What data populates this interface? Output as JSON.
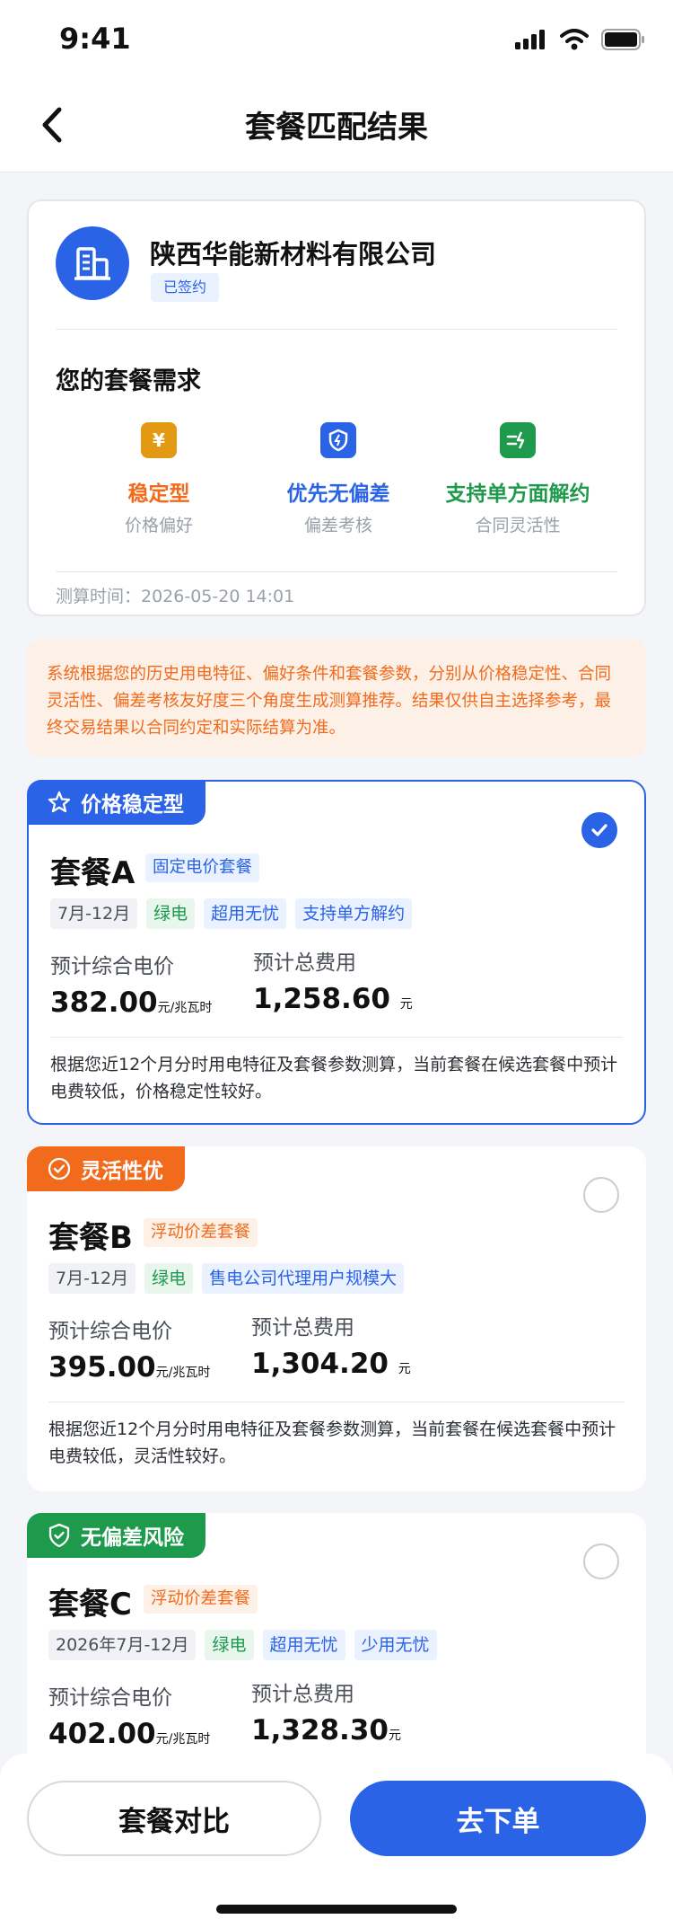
{
  "status_bar": {
    "time": "9:41"
  },
  "nav": {
    "title": "套餐匹配结果"
  },
  "company": {
    "name": "陕西华能新材料有限公司",
    "badge": "已签约",
    "needs_title": "您的套餐需求",
    "needs": [
      {
        "icon": "yen-icon",
        "glyph": "¥",
        "color": "#e39a12",
        "title": "稳定型",
        "title_color": "#f26a1b",
        "sub": "价格偏好"
      },
      {
        "icon": "shield-icon",
        "glyph": "",
        "color": "#2b63e6",
        "title": "优先无偏差",
        "title_color": "#2b63e6",
        "sub": "偏差考核"
      },
      {
        "icon": "flex-icon",
        "glyph": "",
        "color": "#1d9a4b",
        "title": "支持单方面解约",
        "title_color": "#1d9a4b",
        "sub": "合同灵活性"
      }
    ],
    "calc_time": "测算时间：2026-05-20 14:01"
  },
  "notice": "系统根据您的历史用电特征、偏好条件和套餐参数，分别从价格稳定性、合同灵活性、偏差考核友好度三个角度生成测算推荐。结果仅供自主选择参考，最终交易结果以合同约定和实际结算为准。",
  "labels": {
    "price_label": "预计综合电价",
    "total_label": "预计总费用",
    "price_unit": "元/兆瓦时",
    "total_unit": "元"
  },
  "plans": [
    {
      "tag": "价格稳定型",
      "tag_color": "#2b63e6",
      "tag_icon": "star-icon",
      "name": "套餐A",
      "type": "固定电价套餐",
      "type_style": "blue",
      "chips": [
        {
          "text": "7月-12月",
          "style": "gray"
        },
        {
          "text": "绿电",
          "style": "green"
        },
        {
          "text": "超用无忧",
          "style": "blue"
        },
        {
          "text": "支持单方解约",
          "style": "blue"
        }
      ],
      "price": "382.00",
      "total": "1,258.60",
      "desc": "根据您近12个月分时用电特征及套餐参数测算，当前套餐在候选套餐中预计电费较低，价格稳定性较好。",
      "selected": true
    },
    {
      "tag": "灵活性优",
      "tag_color": "#f26a1b",
      "tag_icon": "check-circle-icon",
      "name": "套餐B",
      "type": "浮动价差套餐",
      "type_style": "orange",
      "chips": [
        {
          "text": "7月-12月",
          "style": "gray"
        },
        {
          "text": "绿电",
          "style": "green"
        },
        {
          "text": "售电公司代理用户规模大",
          "style": "blue"
        }
      ],
      "price": "395.00",
      "total": "1,304.20",
      "desc": "根据您近12个月分时用电特征及套餐参数测算，当前套餐在候选套餐中预计电费较低，灵活性较好。",
      "selected": false
    },
    {
      "tag": "无偏差风险",
      "tag_color": "#1d9a4b",
      "tag_icon": "shield-check-icon",
      "name": "套餐C",
      "type": "浮动价差套餐",
      "type_style": "orange",
      "chips": [
        {
          "text": "2026年7月-12月",
          "style": "gray"
        },
        {
          "text": "绿电",
          "style": "green"
        },
        {
          "text": "超用无忧",
          "style": "blue"
        },
        {
          "text": "少用无忧",
          "style": "blue"
        }
      ],
      "price": "402.00",
      "total": "1,328.30",
      "selected": false
    }
  ],
  "bottom": {
    "compare_label": "套餐对比",
    "order_label": "去下单"
  }
}
